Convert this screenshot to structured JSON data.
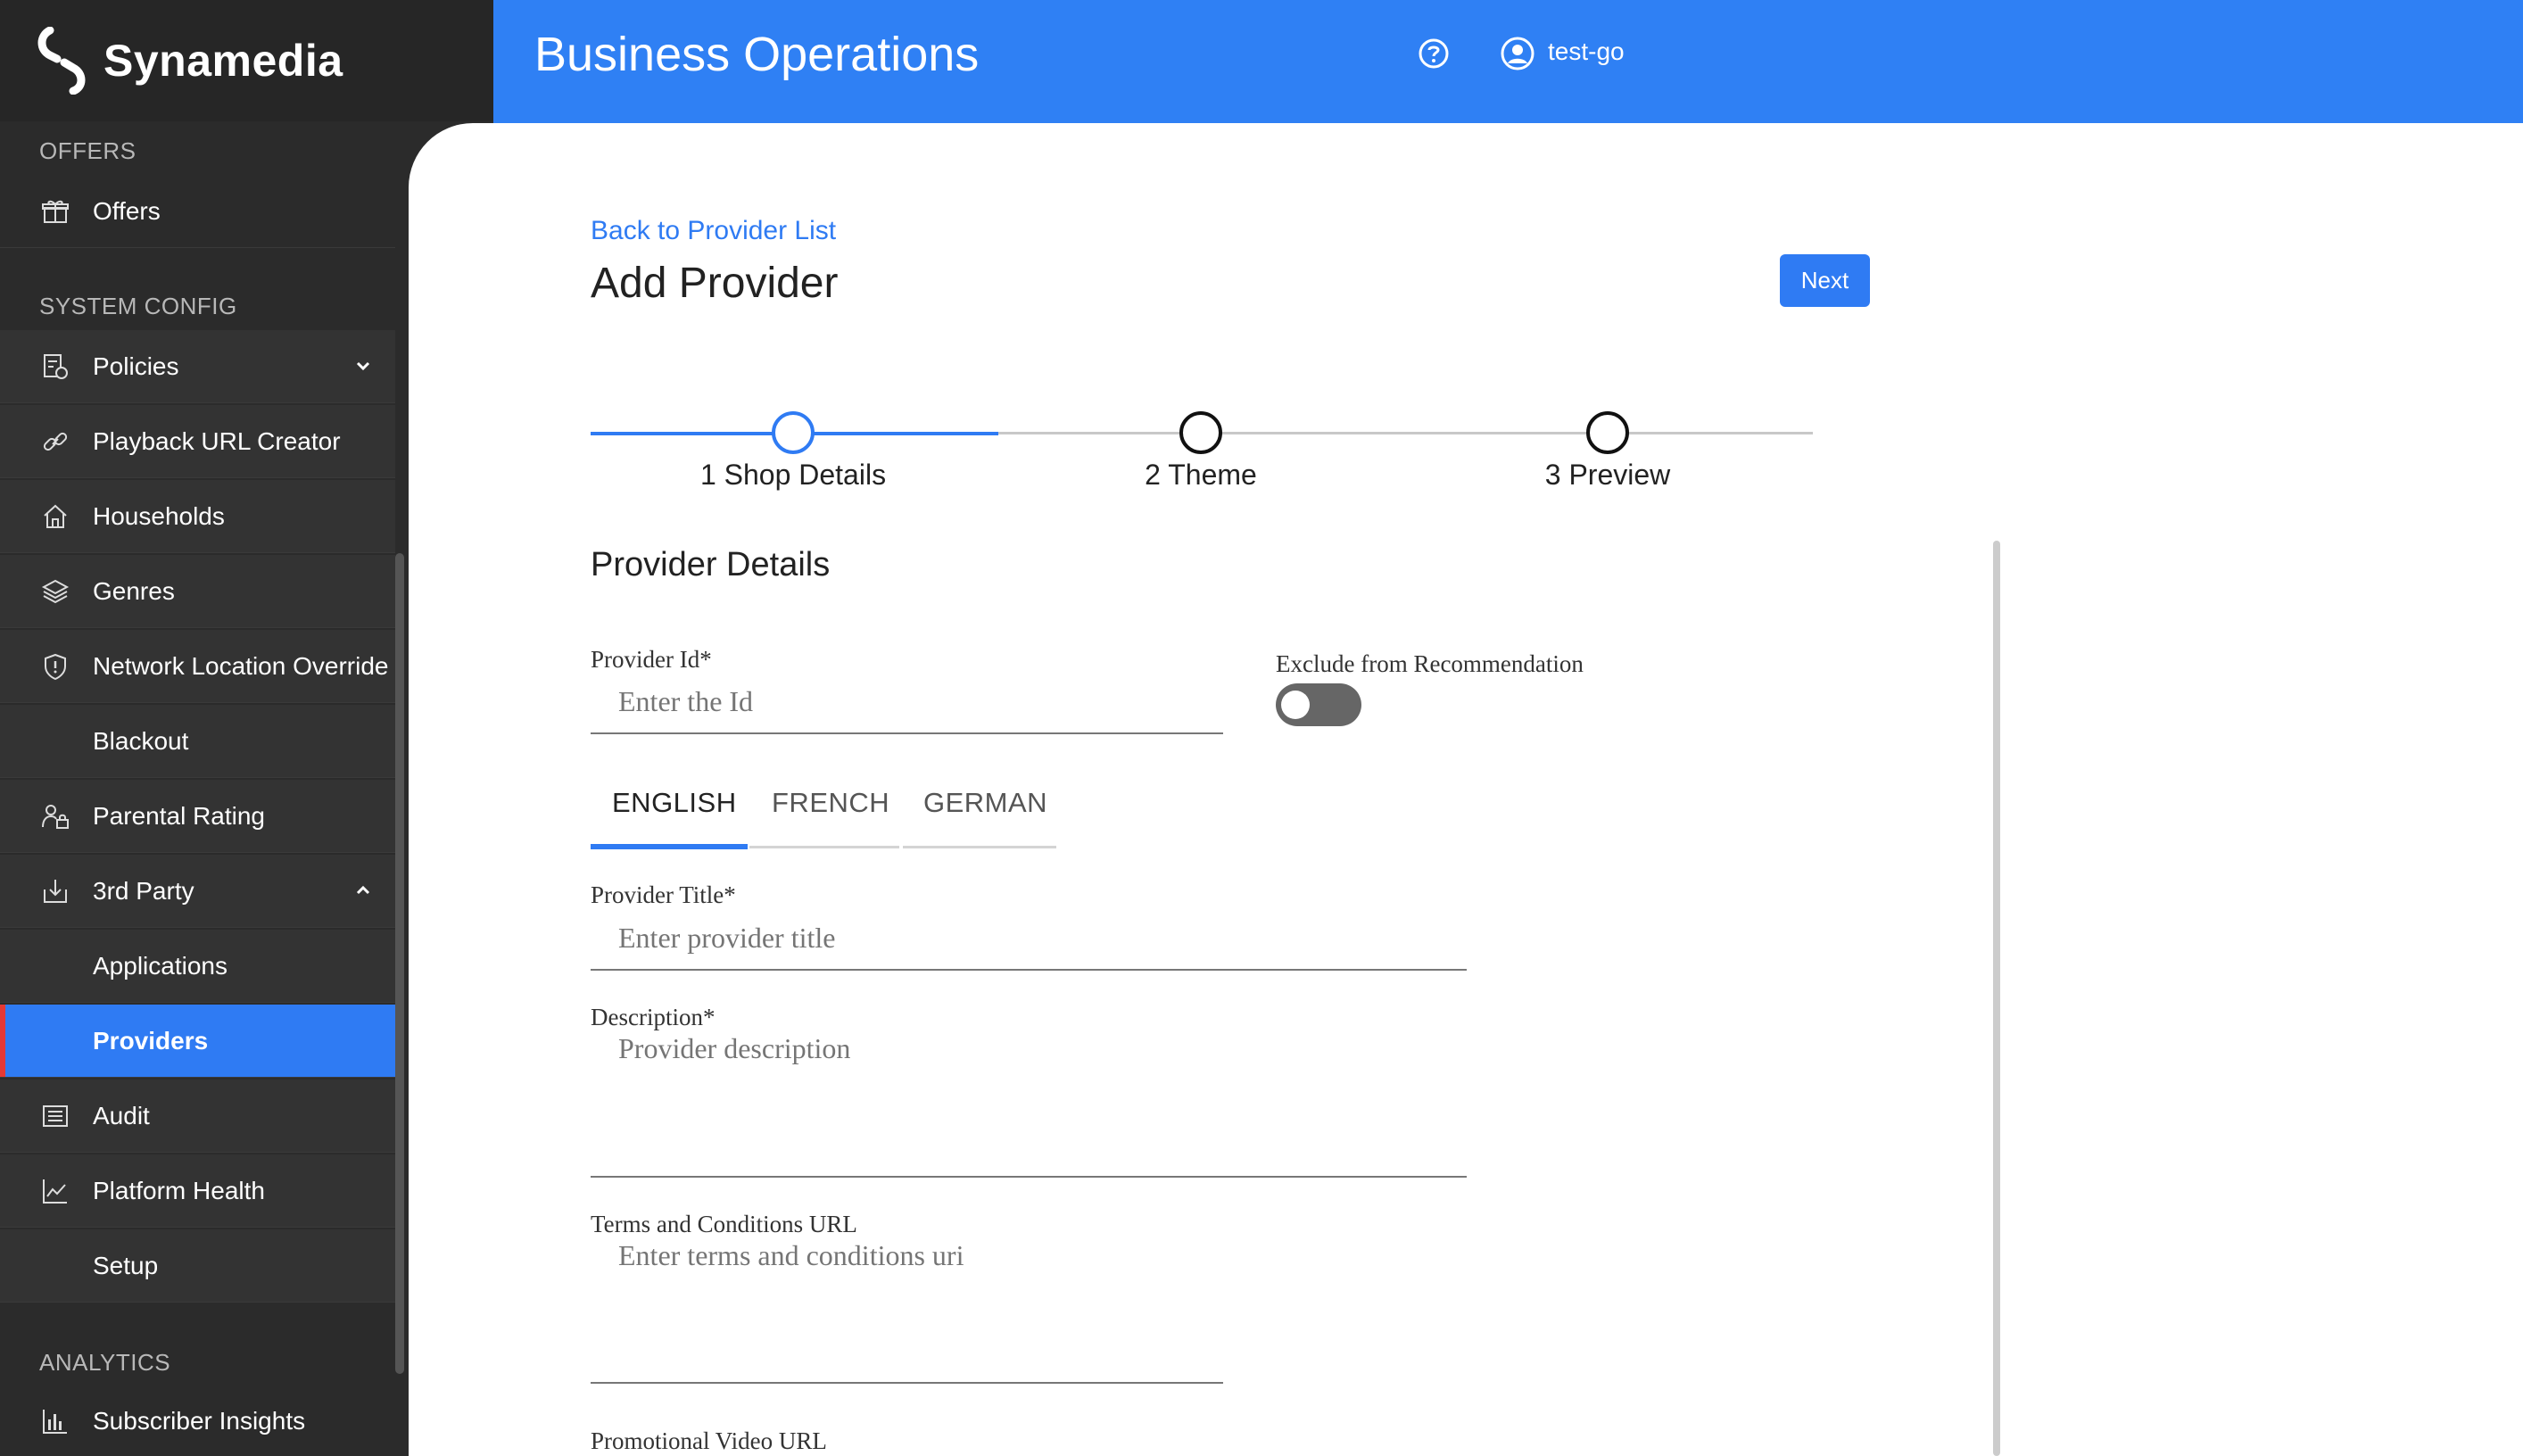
{
  "brand": {
    "name": "Synamedia"
  },
  "header": {
    "title": "Business Operations",
    "user": "test-go"
  },
  "sidebar": {
    "sections": {
      "offers": "OFFERS",
      "system": "SYSTEM CONFIG",
      "analytics": "ANALYTICS"
    },
    "items": {
      "offers": "Offers",
      "policies": "Policies",
      "playback": "Playback URL Creator",
      "households": "Households",
      "genres": "Genres",
      "network": "Network Location Override",
      "blackout": "Blackout",
      "parental": "Parental Rating",
      "third_party": "3rd Party",
      "applications": "Applications",
      "providers": "Providers",
      "audit": "Audit",
      "platform_health": "Platform Health",
      "setup": "Setup",
      "subscriber": "Subscriber Insights"
    }
  },
  "page": {
    "back_link": "Back to Provider List",
    "title": "Add Provider",
    "next_label": "Next",
    "steps": [
      "1 Shop Details",
      "2 Theme",
      "3 Preview"
    ],
    "section_title": "Provider Details"
  },
  "form": {
    "provider_id_label": "Provider Id",
    "provider_id_placeholder": "Enter the Id",
    "exclude_label": "Exclude from Recommendation",
    "tabs": [
      "ENGLISH",
      "FRENCH",
      "GERMAN"
    ],
    "title_label": "Provider Title",
    "title_placeholder": "Enter provider title",
    "description_label": "Description",
    "description_placeholder": "Provider description",
    "terms_label": "Terms and Conditions URL",
    "terms_placeholder": "Enter terms and conditions uri",
    "promo_label": "Promotional Video URL",
    "required_mark": "*"
  },
  "colors": {
    "accent": "#2f7bf3",
    "header": "#2f80f4",
    "sidebar": "#2b2b2b",
    "active_marker": "#e53935"
  }
}
